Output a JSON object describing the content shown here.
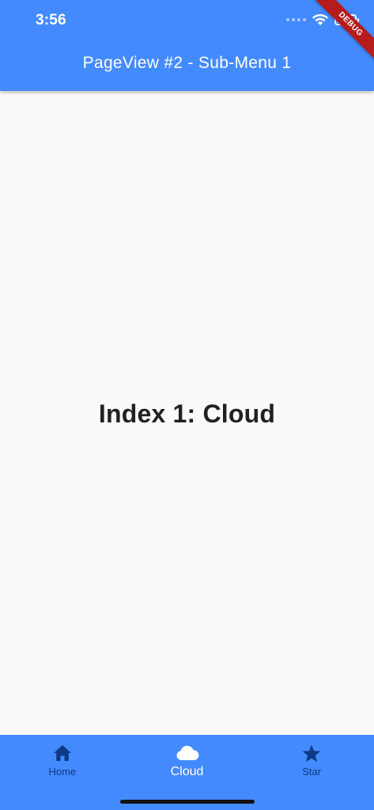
{
  "status_bar": {
    "time": "3:56"
  },
  "app_bar": {
    "title": "PageView #2 - Sub-Menu 1"
  },
  "debug_banner": {
    "label": "DEBUG",
    "color": "#b71c1c"
  },
  "content": {
    "heading": "Index 1: Cloud"
  },
  "bottom_nav": {
    "items": [
      {
        "label": "Home",
        "icon": "home-icon",
        "active": false
      },
      {
        "label": "Cloud",
        "icon": "cloud-icon",
        "active": true
      },
      {
        "label": "Star",
        "icon": "star-icon",
        "active": false
      }
    ]
  },
  "colors": {
    "primary": "#448aff",
    "inactive_item": "#0d3a85",
    "active_item": "#ffffff",
    "background": "#fafafa",
    "heading_text": "#212121"
  }
}
